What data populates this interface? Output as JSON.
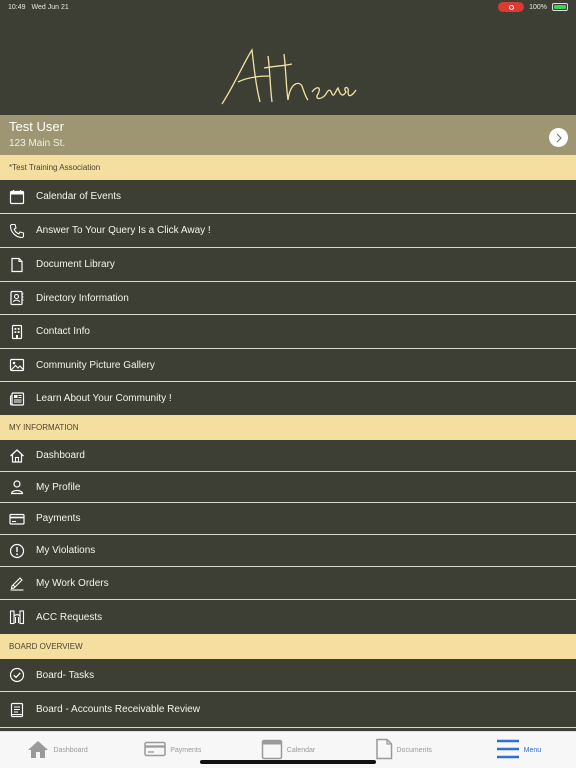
{
  "status": {
    "time": "10:49",
    "date": "Wed Jun 21",
    "battery": "100%"
  },
  "brand": {
    "logo_text": "Athena"
  },
  "user": {
    "name": "Test User",
    "address": "123 Main St."
  },
  "association": "*Test Training Association",
  "menu1": [
    {
      "label": "Calendar of Events",
      "icon": "calendar-icon"
    },
    {
      "label": "Answer To Your Query Is a Click Away !",
      "icon": "phone-icon"
    },
    {
      "label": "Document Library",
      "icon": "document-icon"
    },
    {
      "label": "Directory Information",
      "icon": "directory-icon"
    },
    {
      "label": "Contact Info",
      "icon": "building-icon"
    },
    {
      "label": "Community Picture Gallery",
      "icon": "image-icon"
    },
    {
      "label": "Learn About Your Community !",
      "icon": "newspaper-icon"
    }
  ],
  "section_my_info": "MY INFORMATION",
  "menu2": [
    {
      "label": "Dashboard",
      "icon": "home-icon"
    },
    {
      "label": "My Profile",
      "icon": "person-icon"
    },
    {
      "label": "Payments",
      "icon": "card-icon"
    },
    {
      "label": "My Violations",
      "icon": "alert-icon"
    },
    {
      "label": "My Work Orders",
      "icon": "pen-icon"
    },
    {
      "label": "ACC Requests",
      "icon": "acc-icon"
    }
  ],
  "section_board": "BOARD OVERVIEW",
  "menu3": [
    {
      "label": "Board- Tasks",
      "icon": "check-circle-icon"
    },
    {
      "label": "Board - Accounts Receivable Review",
      "icon": "book-icon"
    }
  ],
  "tabs": [
    {
      "label": "Dashboard",
      "icon": "home-icon"
    },
    {
      "label": "Payments",
      "icon": "card-icon"
    },
    {
      "label": "Calendar",
      "icon": "calendar-icon"
    },
    {
      "label": "Documents",
      "icon": "document-icon"
    },
    {
      "label": "Menu",
      "icon": "menu-icon",
      "active": true
    }
  ],
  "colors": {
    "background": "#3d3e34",
    "user_band": "#9e9673",
    "section": "#f4dea0",
    "active_tab": "#2f6fd6"
  }
}
